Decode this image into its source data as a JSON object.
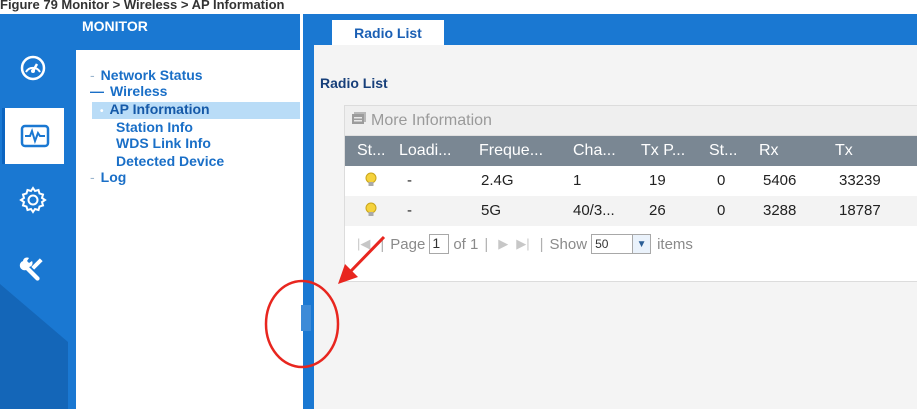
{
  "caption": "Figure 79  Monitor > Wireless > AP Information",
  "sidebar": {
    "title": "MONITOR",
    "icons": [
      "speedometer-icon",
      "heartbeat-monitor-icon",
      "gear-icon",
      "tools-icon"
    ],
    "items": [
      {
        "label": "Network Status"
      },
      {
        "label": "Wireless"
      },
      {
        "label": "AP Information"
      },
      {
        "label": "Station Info"
      },
      {
        "label": "WDS Link Info"
      },
      {
        "label": "Detected Device"
      },
      {
        "label": "Log"
      }
    ]
  },
  "tab": {
    "label": "Radio List"
  },
  "section": {
    "title": "Radio List"
  },
  "toolbar": {
    "more_info_label": "More Information"
  },
  "table": {
    "columns": [
      "St...",
      "Loadi...",
      "Freque...",
      "Cha...",
      "Tx P...",
      "St...",
      "Rx",
      "Tx"
    ],
    "rows": [
      {
        "status": "bulb-icon",
        "loading": "-",
        "frequency": "2.4G",
        "channel": "1",
        "tx_power": "19",
        "stations": "0",
        "rx": "5406",
        "tx": "33239"
      },
      {
        "status": "bulb-icon",
        "loading": "-",
        "frequency": "5G",
        "channel": "40/3...",
        "tx_power": "26",
        "stations": "0",
        "rx": "3288",
        "tx": "18787"
      }
    ]
  },
  "pager": {
    "page_label": "Page",
    "page_value": "1",
    "of_label": "of 1",
    "show_label": "Show",
    "per_page": "50",
    "items_label": "items"
  },
  "colors": {
    "brand_blue": "#1a78d2",
    "header_gray": "#7a8793",
    "callout_red": "#e8261f"
  }
}
